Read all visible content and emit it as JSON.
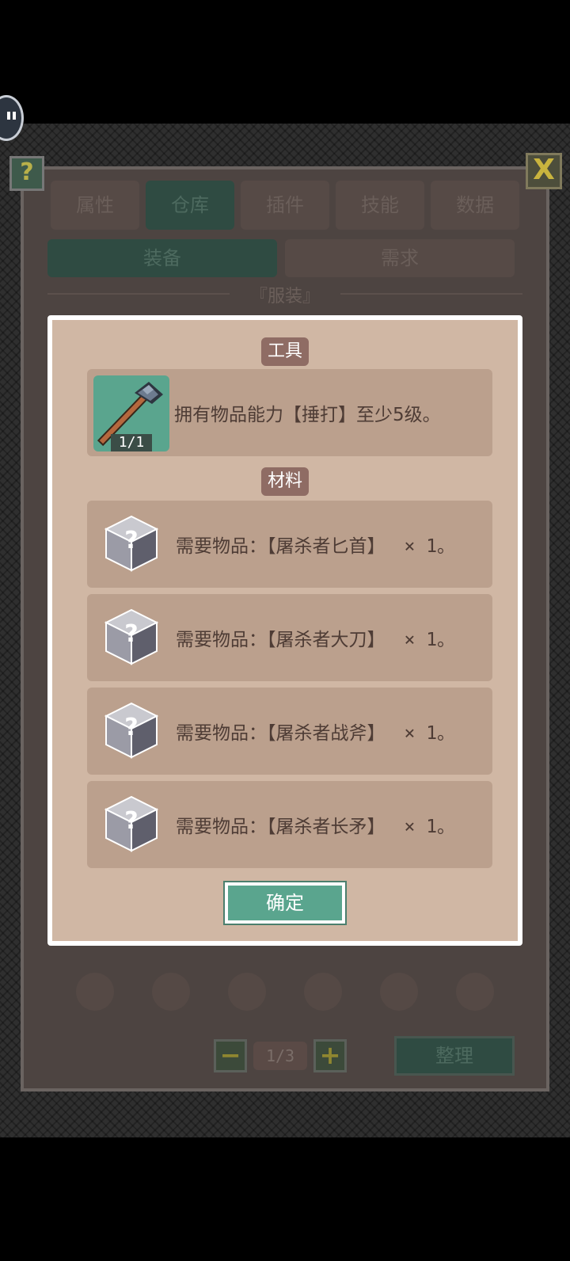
{
  "background": {
    "tabs": [
      "属性",
      "仓库",
      "插件",
      "技能",
      "数据"
    ],
    "active_tab_index": 1,
    "subtabs": [
      "装备",
      "需求"
    ],
    "section_label": "『服装』",
    "pager": {
      "minus": "−",
      "page": "1/3",
      "plus": "+"
    },
    "sort_label": "整理",
    "help_label": "?",
    "close_label": "X"
  },
  "dialog": {
    "tool_header": "工具",
    "tool": {
      "icon": "hammer-icon",
      "count": "1/1",
      "description": "拥有物品能力【捶打】至少5级。"
    },
    "materials_header": "材料",
    "materials": [
      {
        "icon": "unknown-item-cube-icon",
        "text": "需要物品：【屠杀者匕首】",
        "qty": "× 1。"
      },
      {
        "icon": "unknown-item-cube-icon",
        "text": "需要物品：【屠杀者大刀】",
        "qty": "× 1。"
      },
      {
        "icon": "unknown-item-cube-icon",
        "text": "需要物品：【屠杀者战斧】",
        "qty": "× 1。"
      },
      {
        "icon": "unknown-item-cube-icon",
        "text": "需要物品：【屠杀者长矛】",
        "qty": "× 1。"
      }
    ],
    "confirm_label": "确定"
  },
  "colors": {
    "dialog_bg": "#d0b7a4",
    "card_bg": "#bba08d",
    "tag_bg": "#8f6c64",
    "confirm_bg": "#5aa58e",
    "text": "#4e3c35"
  }
}
